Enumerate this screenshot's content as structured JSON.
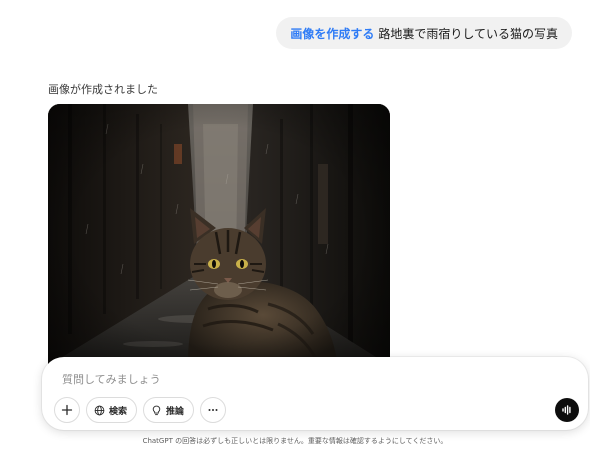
{
  "user_message": {
    "command": "画像を作成する",
    "text": "路地裏で雨宿りしている猫の写真"
  },
  "assistant": {
    "status": "画像が作成されました"
  },
  "composer": {
    "placeholder": "質問してみましょう",
    "search_label": "検索",
    "reason_label": "推論"
  },
  "footer": {
    "disclaimer": "ChatGPT の回答は必ずしも正しいとは限りません。重要な情報は確認するようにしてください。"
  },
  "icons": {
    "add": "plus-icon",
    "search": "globe-icon",
    "reason": "lightbulb-icon",
    "more": "ellipsis-icon",
    "voice": "voice-wave-icon",
    "download": "arrow-down-icon"
  },
  "colors": {
    "accent": "#2f7cf6",
    "bubble": "#f1f1f1",
    "voice_button": "#0d0d0d"
  }
}
